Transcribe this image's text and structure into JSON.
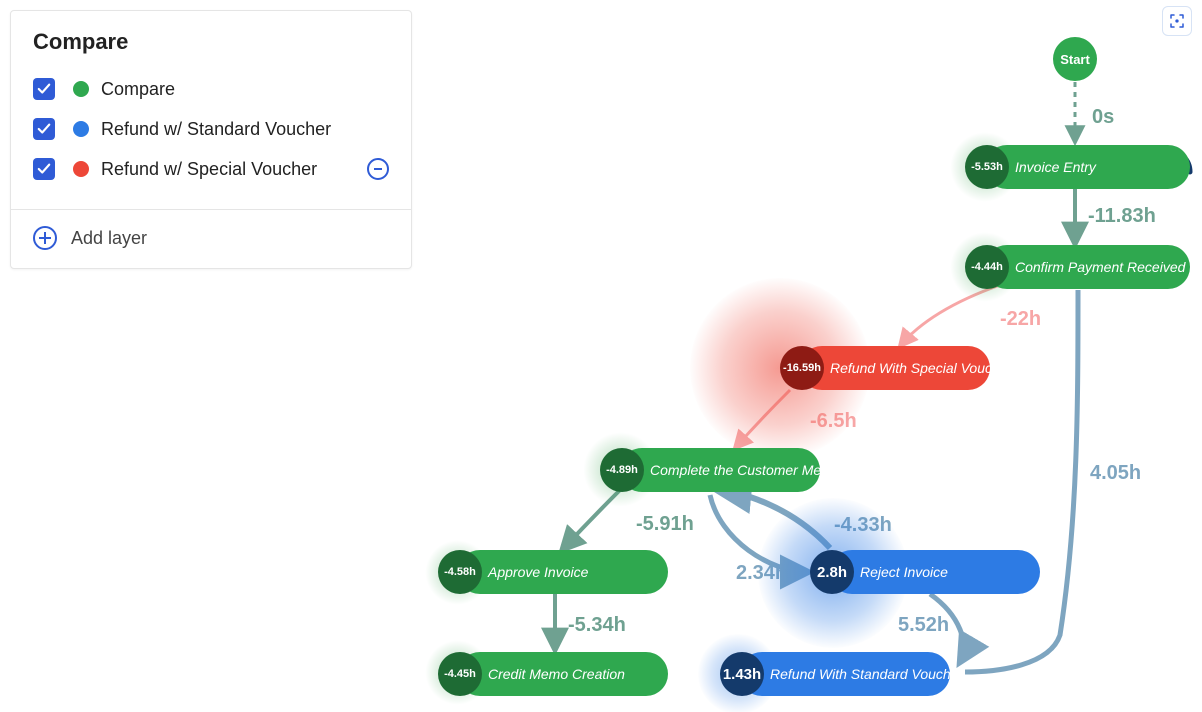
{
  "panel": {
    "title": "Compare",
    "layers": [
      {
        "label": "Compare",
        "color": "#2fa84f",
        "checked": true,
        "removable": false
      },
      {
        "label": "Refund w/ Standard Voucher",
        "color": "#2d7be4",
        "checked": true,
        "removable": false
      },
      {
        "label": "Refund w/ Special Voucher",
        "color": "#ed4738",
        "checked": true,
        "removable": true
      }
    ],
    "addLayer": "Add layer"
  },
  "capture_tooltip": "Capture",
  "graph": {
    "start": {
      "label": "Start"
    },
    "nodes": {
      "invoice_entry": {
        "label": "Invoice Entry",
        "badge": "-5.53h",
        "color": "green"
      },
      "confirm_payment": {
        "label": "Confirm Payment Received",
        "badge": "-4.44h",
        "color": "green"
      },
      "refund_special": {
        "label": "Refund With Special Voucher",
        "badge": "-16.59h",
        "color": "red"
      },
      "complete_memo": {
        "label": "Complete the Customer Memo",
        "badge": "-4.89h",
        "color": "green"
      },
      "approve_invoice": {
        "label": "Approve Invoice",
        "badge": "-4.58h",
        "color": "green"
      },
      "reject_invoice": {
        "label": "Reject Invoice",
        "badge": "2.8h",
        "color": "blue"
      },
      "credit_memo": {
        "label": "Credit Memo Creation",
        "badge": "-4.45h",
        "color": "green"
      },
      "refund_standard": {
        "label": "Refund With Standard Voucher",
        "badge": "1.43h",
        "color": "blue"
      }
    },
    "edges": {
      "start_to_invoice": {
        "label": "0s"
      },
      "invoice_to_confirm": {
        "label": "-11.83h"
      },
      "confirm_to_special": {
        "label": "-22h"
      },
      "special_to_memo": {
        "label": "-6.5h"
      },
      "confirm_to_reject": {
        "label": "4.05h"
      },
      "memo_to_approve": {
        "label": "-5.91h"
      },
      "approve_to_credit": {
        "label": "-5.34h"
      },
      "reject_to_memo": {
        "label": "-4.33h"
      },
      "memo_to_reject": {
        "label": "2.34h"
      },
      "reject_to_standard": {
        "label": "5.52h"
      }
    }
  }
}
